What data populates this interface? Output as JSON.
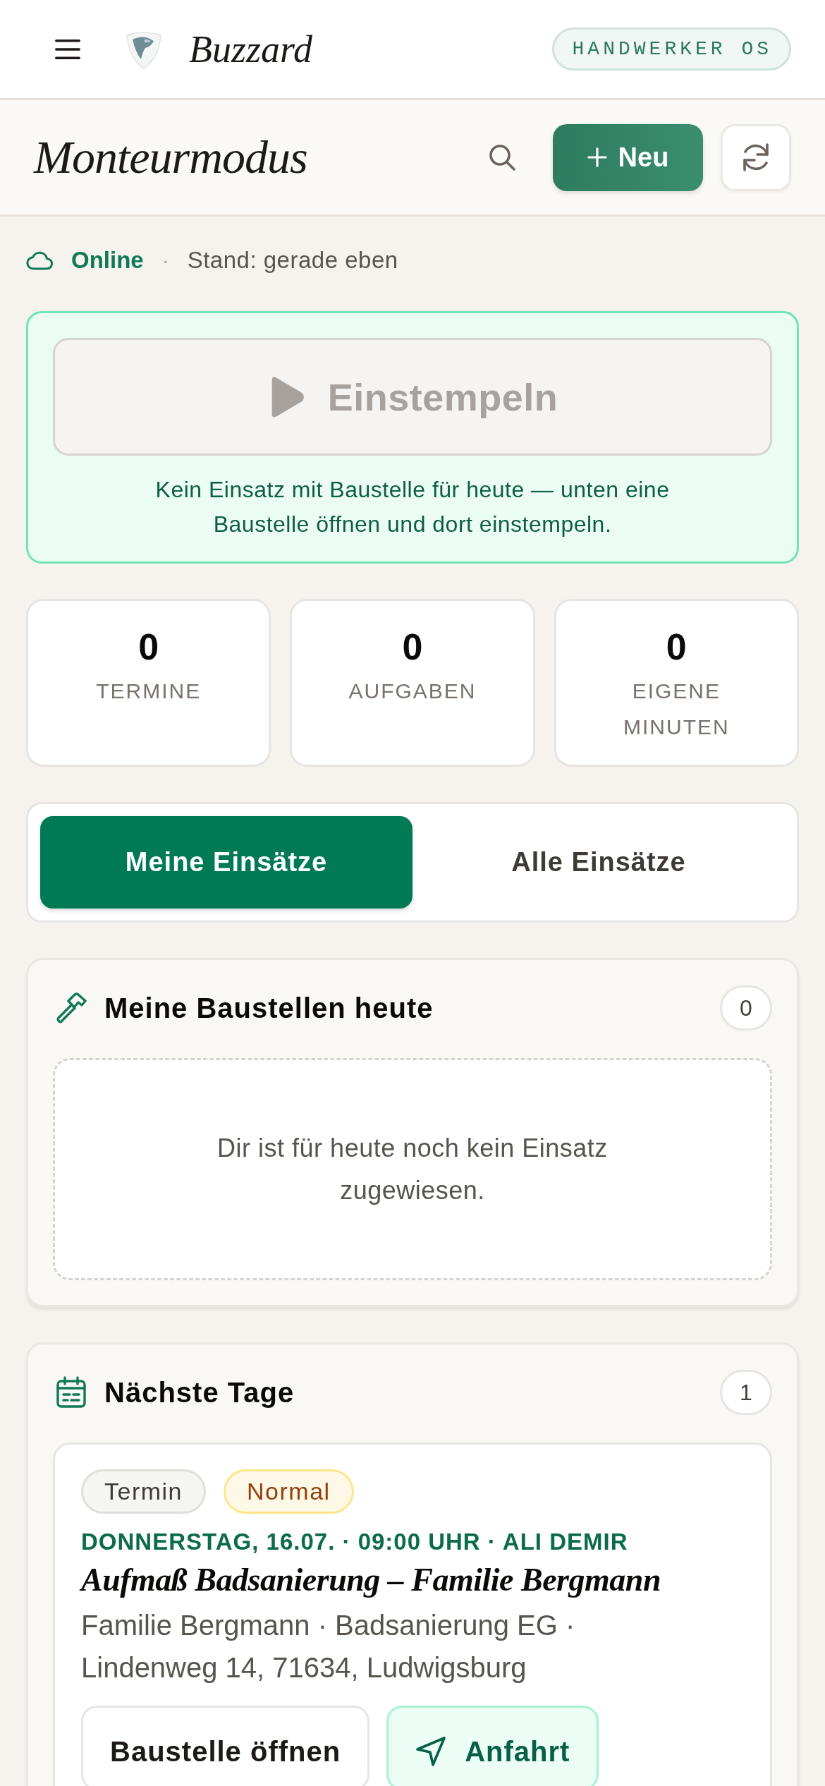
{
  "app_bar": {
    "title": "Buzzard",
    "badge": "HANDWERKER OS"
  },
  "toolbar": {
    "title": "Monteurmodus",
    "new_button": {
      "label": "Neu"
    }
  },
  "status": {
    "connection": "Online",
    "separator": "·",
    "updated": "Stand: gerade eben"
  },
  "clock_in": {
    "button": {
      "label": "Einstempeln",
      "disabled": true
    },
    "hint": "Kein Einsatz mit Baustelle für heute — unten eine Baustelle öffnen und dort einstempeln."
  },
  "stats": [
    {
      "value": "0",
      "label": "TERMINE"
    },
    {
      "value": "0",
      "label": "AUFGABEN"
    },
    {
      "value": "0",
      "label": "EIGENE MINUTEN"
    }
  ],
  "tabs": [
    {
      "label": "Meine Einsätze",
      "selected": true
    },
    {
      "label": "Alle Einsätze",
      "selected": false
    }
  ],
  "sections": [
    {
      "kind": "today",
      "title": "Meine Baustellen heute",
      "count": "0",
      "empty_text": "Dir ist für heute noch kein Einsatz zugewiesen."
    },
    {
      "kind": "upcoming",
      "title": "Nächste Tage",
      "count": "1",
      "items": [
        {
          "chips": [
            {
              "kind": "type",
              "label": "Termin"
            },
            {
              "kind": "priority",
              "label": "Normal"
            }
          ],
          "meta": "DONNERSTAG, 16.07. · 09:00 UHR · ALI DEMIR",
          "title": "Aufmaß Badsanierung – Familie Bergmann",
          "address": "Familie Bergmann · Badsanierung EG · Lindenweg 14, 71634, Ludwigsburg",
          "actions": [
            {
              "kind": "open",
              "label": "Baustelle öffnen"
            },
            {
              "kind": "directions",
              "label": "Anfahrt"
            }
          ]
        }
      ]
    }
  ]
}
